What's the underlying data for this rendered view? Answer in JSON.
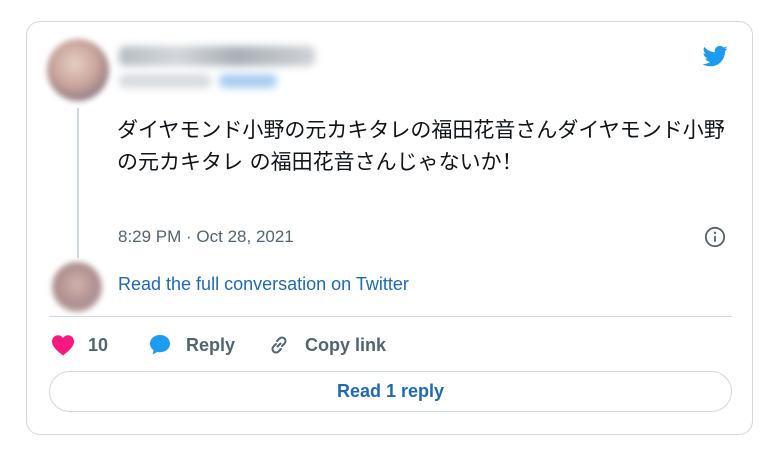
{
  "tweet": {
    "text": "ダイヤモンド小野の元カキタレの福田花音さんダイヤモンド小野の元カキタレ の福田花音さんじゃないか！",
    "time": "8:29 PM",
    "separator": " · ",
    "date": "Oct 28, 2021"
  },
  "conversation": {
    "read_full_label": "Read the full conversation on Twitter"
  },
  "actions": {
    "like_count": "10",
    "reply_label": "Reply",
    "copy_link_label": "Copy link"
  },
  "footer": {
    "read_reply_label": "Read 1 reply"
  },
  "icons": {
    "brand": "twitter-bird-icon",
    "info": "info-icon",
    "like": "heart-icon",
    "reply": "speech-bubble-icon",
    "copy": "link-icon"
  },
  "colors": {
    "brand_blue": "#1d9bf0",
    "link_blue": "#1d6bb5",
    "like_pink": "#f91880",
    "muted_text": "#536471",
    "border": "#cfd9de"
  }
}
